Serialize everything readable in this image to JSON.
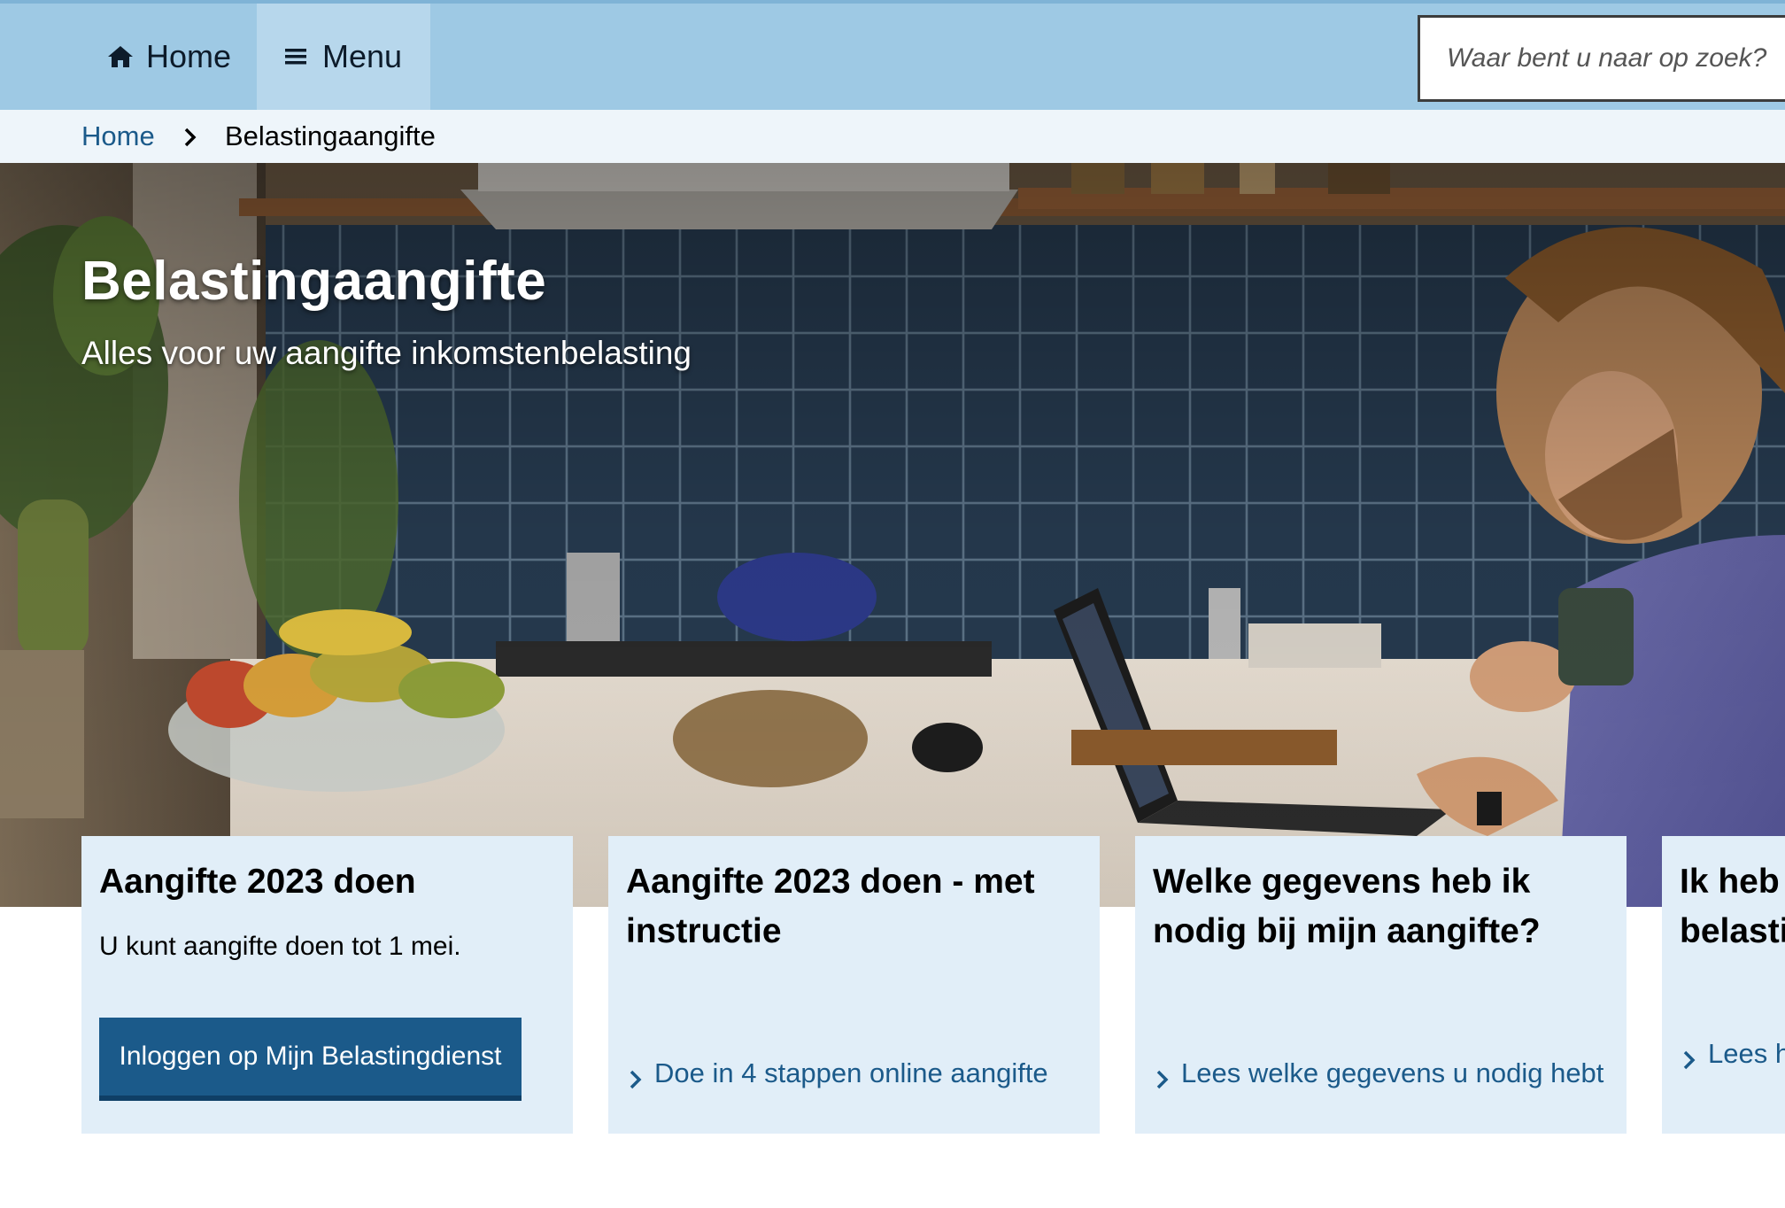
{
  "nav": {
    "home_label": "Home",
    "menu_label": "Menu",
    "search_placeholder": "Waar bent u naar op zoek?"
  },
  "breadcrumb": {
    "home": "Home",
    "current": "Belastingaangifte"
  },
  "hero": {
    "title": "Belastingaangifte",
    "subtitle": "Alles voor uw aangifte inkomstenbelasting"
  },
  "cards": [
    {
      "title": "Aangifte 2023 doen",
      "text": "U kunt aangifte doen tot 1 mei.",
      "button": "Inloggen op Mijn Belastingdienst"
    },
    {
      "title": "Aangifte 2023 doen - met instructie",
      "link": "Doe in 4 stappen online aangifte"
    },
    {
      "title": "Welke gegevens heb ik nodig bij mijn aangifte?",
      "link": "Lees welke gegevens u nodig hebt"
    },
    {
      "title": "Ik heb belasti",
      "link": "Lees h aangif"
    }
  ],
  "colors": {
    "header_bg": "#9ec9e4",
    "menu_bg": "#b7d7ec",
    "breadcrumb_bg": "#eef5fa",
    "card_bg": "#e1eef8",
    "link": "#1b5a8a",
    "button_bg": "#1b5a8a"
  }
}
